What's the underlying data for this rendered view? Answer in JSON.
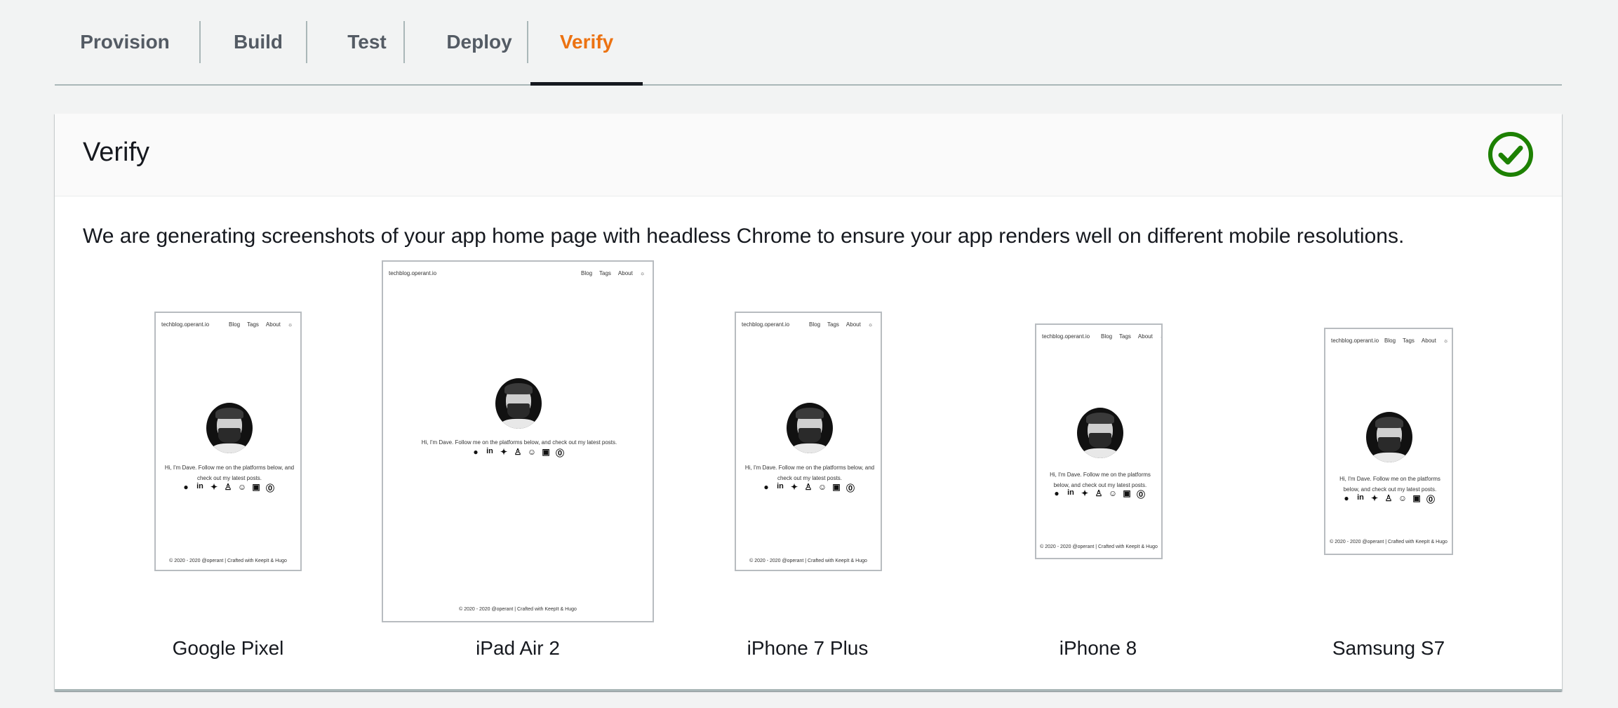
{
  "tabs": [
    {
      "label": "Provision",
      "active": false
    },
    {
      "label": "Build",
      "active": false
    },
    {
      "label": "Test",
      "active": false
    },
    {
      "label": "Deploy",
      "active": false
    },
    {
      "label": "Verify",
      "active": true
    }
  ],
  "panel": {
    "title": "Verify",
    "status_icon": "check-circle-icon",
    "status_color": "#1d8102",
    "description": "We are generating screenshots of your app home page with headless Chrome to ensure your app renders well on different mobile resolutions."
  },
  "site": {
    "title": "techblog.operant.io",
    "nav": [
      "Blog",
      "Tags",
      "About"
    ],
    "theme_icon": "sun-icon",
    "bio": "Hi, I'm Dave. Follow me on the platforms below, and check out my latest posts.",
    "social_icons": [
      "github-icon",
      "linkedin-icon",
      "twitter-icon",
      "keybase-icon",
      "reddit-icon",
      "stackshare-icon",
      "mastodon-icon"
    ],
    "footer": "© 2020 - 2020 @operant | Crafted with KeepIt & Hugo"
  },
  "devices": [
    {
      "name": "Google Pixel"
    },
    {
      "name": "iPad Air 2"
    },
    {
      "name": "iPhone 7 Plus"
    },
    {
      "name": "iPhone 8"
    },
    {
      "name": "Samsung S7"
    }
  ],
  "colors": {
    "accent": "#ec7211",
    "text": "#16191f",
    "muted": "#545b64"
  }
}
